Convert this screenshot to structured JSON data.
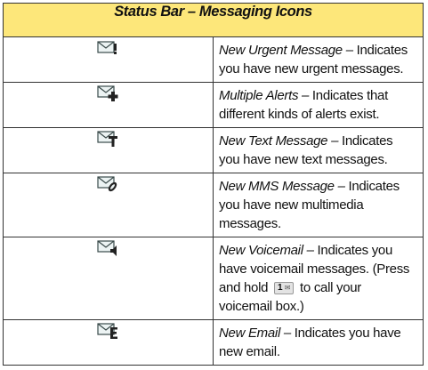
{
  "title": "Status Bar – Messaging Icons",
  "rows": [
    {
      "icon": "urgent-message-icon",
      "term": "New Urgent Message",
      "sep": " – ",
      "desc": "Indicates you have new urgent messages."
    },
    {
      "icon": "multiple-alerts-icon",
      "term": "Multiple Alerts",
      "sep": " – ",
      "desc": "Indicates that different kinds of alerts exist."
    },
    {
      "icon": "text-message-icon",
      "term": "New Text Message",
      "sep": " – ",
      "desc": "Indicates you have new text messages."
    },
    {
      "icon": "mms-message-icon",
      "term": "New MMS Message",
      "sep": " – ",
      "desc": "Indicates you have new multimedia messages."
    },
    {
      "icon": "voicemail-icon",
      "term": "New Voicemail",
      "sep": " – ",
      "desc_before": "Indicates you have voicemail messages. (Press and hold",
      "key_label": "1",
      "desc_after": "to call your voicemail box.)"
    },
    {
      "icon": "email-icon",
      "term": "New Email",
      "sep": " – ",
      "desc": "Indicates you have new email."
    }
  ]
}
